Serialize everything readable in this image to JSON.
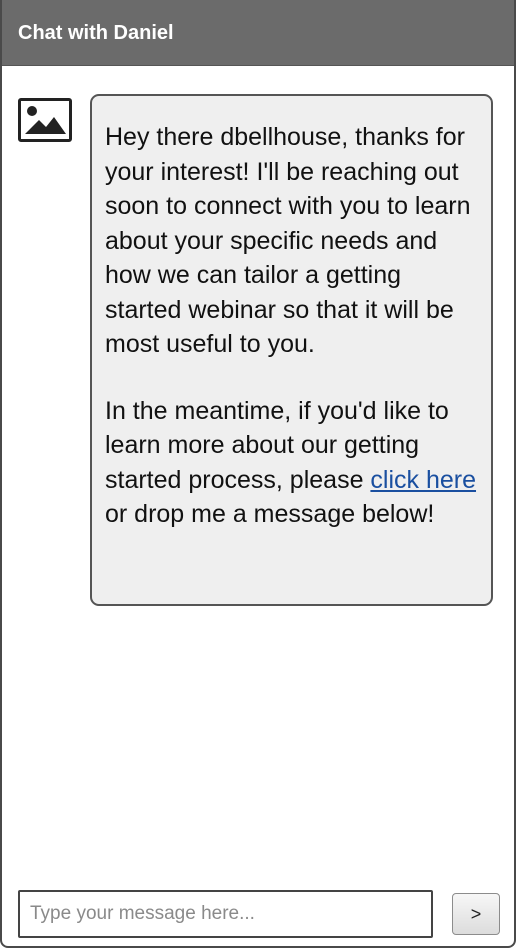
{
  "header": {
    "title": "Chat with Daniel"
  },
  "agent": {
    "avatar_icon": "image-placeholder-icon"
  },
  "message": {
    "paragraph1": "Hey there dbellhouse, thanks for your interest!  I'll be reaching out soon to connect with you to learn about your specific needs and how we can tailor a getting started webinar so that it will be most useful to you.",
    "paragraph2_before": "In the meantime, if you'd like to learn more about our getting started process, please ",
    "link_text": "click here",
    "paragraph2_after": " or drop me a message below!"
  },
  "composer": {
    "placeholder": "Type your message here...",
    "value": "",
    "send_label": ">"
  },
  "colors": {
    "header_bg": "#6b6b6b",
    "bubble_bg": "#efefef",
    "link": "#1a4fa0"
  }
}
